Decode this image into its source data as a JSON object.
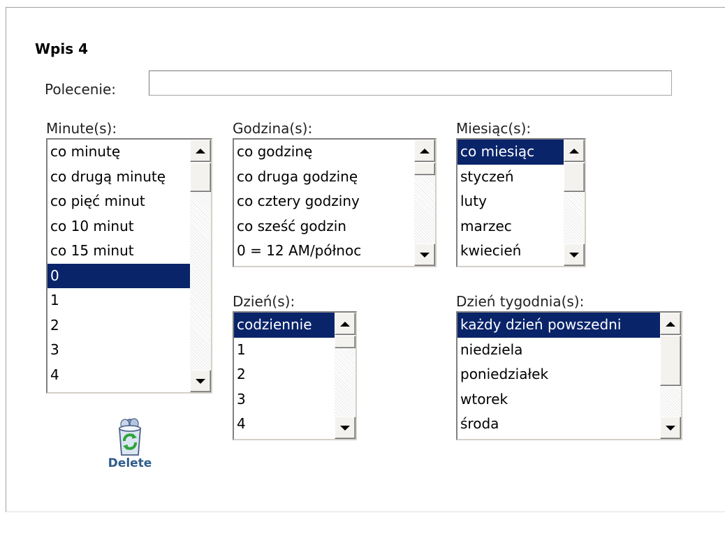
{
  "entry": {
    "title": "Wpis 4"
  },
  "command": {
    "label": "Polecenie:",
    "value": ""
  },
  "minutes": {
    "label": "Minute(s):",
    "options": [
      "co minutę",
      "co drugą minutę",
      "co pięć minut",
      "co 10 minut",
      "co 15 minut",
      "0",
      "1",
      "2",
      "3",
      "4"
    ],
    "selected": "0"
  },
  "hours": {
    "label": "Godzina(s):",
    "options": [
      "co godzinę",
      "co druga godzinę",
      "co cztery godziny",
      "co sześć godzin",
      "0 = 12 AM/północ"
    ],
    "selected": ""
  },
  "months": {
    "label": "Miesiąc(s):",
    "options": [
      "co miesiąc",
      "styczeń",
      "luty",
      "marzec",
      "kwiecień"
    ],
    "selected": "co miesiąc"
  },
  "days": {
    "label": "Dzień(s):",
    "options": [
      "codziennie",
      "1",
      "2",
      "3",
      "4"
    ],
    "selected": "codziennie"
  },
  "weekdays": {
    "label": "Dzień tygodnia(s):",
    "options": [
      "każdy dzień powszedni",
      "niedziela",
      "poniedziałek",
      "wtorek",
      "środa"
    ],
    "selected": "każdy dzień powszedni"
  },
  "delete": {
    "label": "Delete",
    "icon": "recycle-bin-icon"
  },
  "colors": {
    "selection": "#0a246a",
    "delete_text": "#2f5d8a"
  }
}
